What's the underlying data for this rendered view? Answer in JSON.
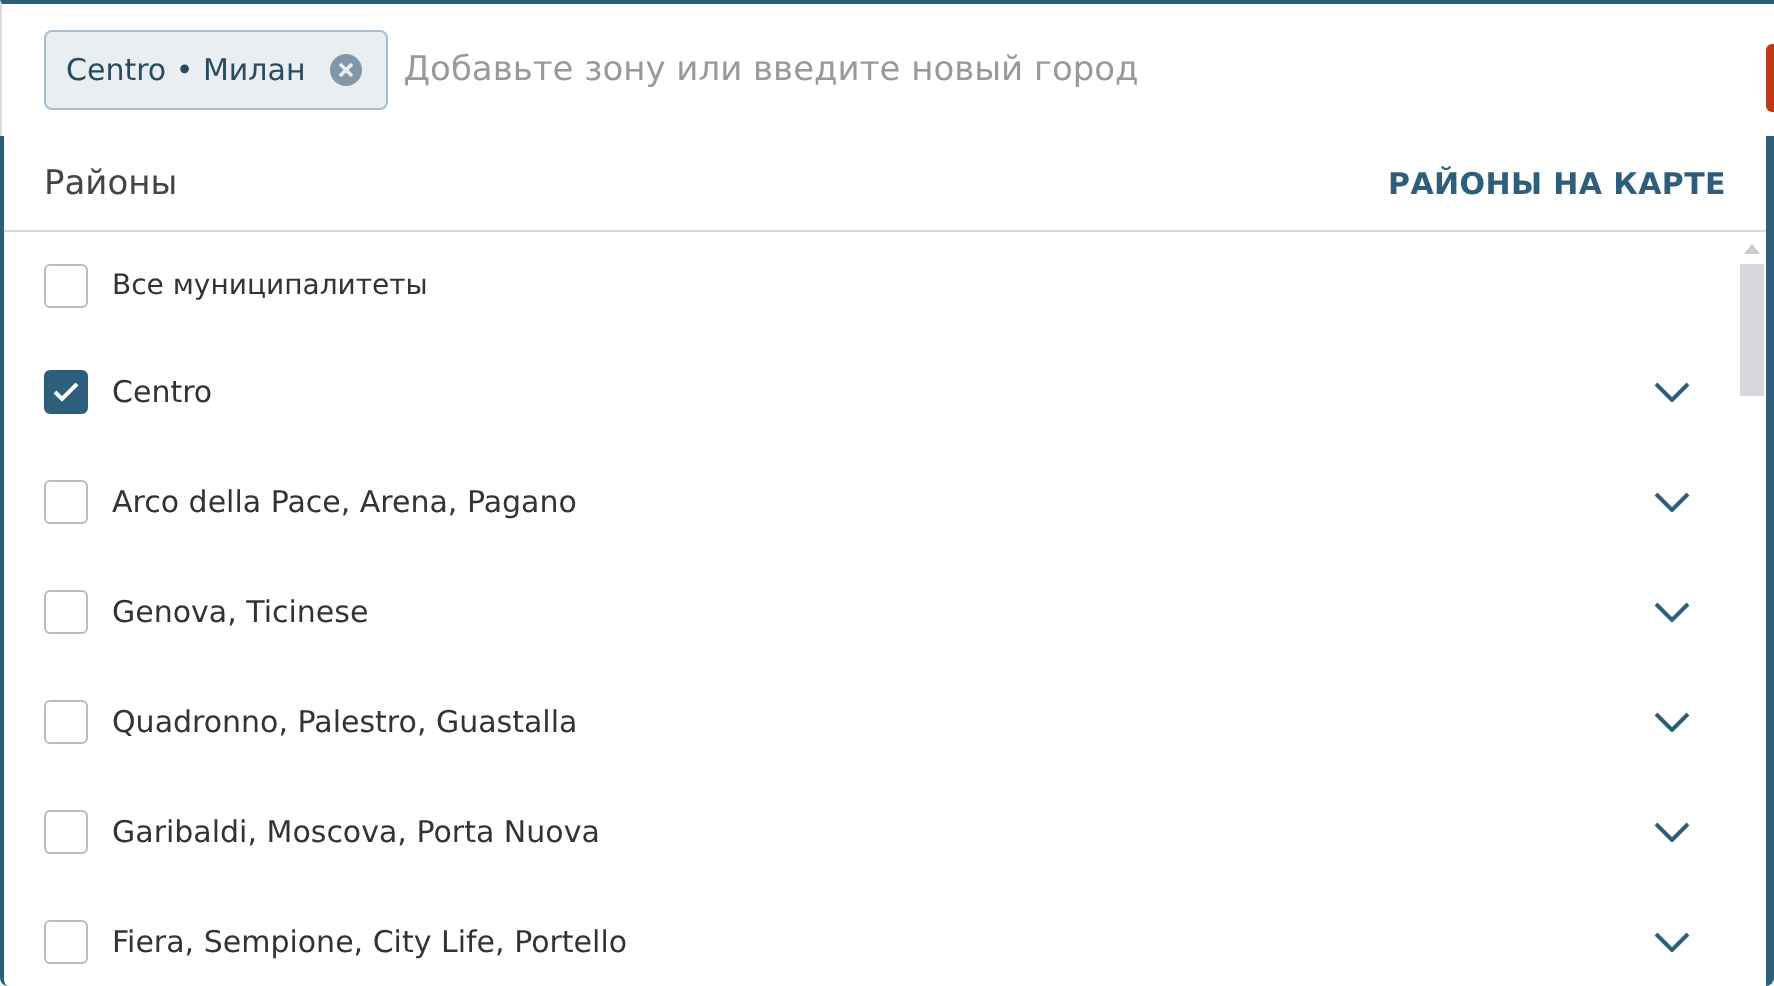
{
  "search": {
    "chips": [
      {
        "label": "Centro • Милан"
      }
    ],
    "placeholder": "Добавьте зону или введите новый город"
  },
  "panel": {
    "title": "Районы",
    "map_link": "РАЙОНЫ НА КАРТЕ",
    "items": [
      {
        "kind": "all",
        "label": "Все муниципалитеты",
        "checked": false
      },
      {
        "kind": "district",
        "label": "Centro",
        "checked": true
      },
      {
        "kind": "district",
        "label": "Arco della Pace, Arena, Pagano",
        "checked": false
      },
      {
        "kind": "district",
        "label": "Genova, Ticinese",
        "checked": false
      },
      {
        "kind": "district",
        "label": "Quadronno, Palestro, Guastalla",
        "checked": false
      },
      {
        "kind": "district",
        "label": "Garibaldi, Moscova, Porta Nuova",
        "checked": false
      },
      {
        "kind": "district",
        "label": "Fiera, Sempione, City Life, Portello",
        "checked": false
      }
    ]
  }
}
